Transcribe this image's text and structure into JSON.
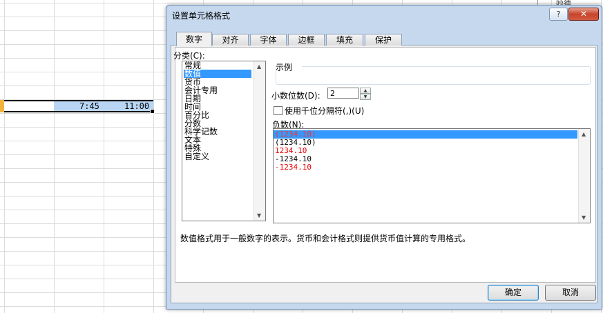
{
  "spreadsheet": {
    "cells": [
      "7:45",
      "11:00"
    ],
    "top_right_label": "吵德"
  },
  "dialog": {
    "title": "设置单元格格式",
    "help_label": "?",
    "close_label": "✕",
    "tabs": [
      "数字",
      "对齐",
      "字体",
      "边框",
      "填充",
      "保护"
    ],
    "category_label": "分类(C):",
    "categories": [
      "常规",
      "数值",
      "货币",
      "会计专用",
      "日期",
      "时间",
      "百分比",
      "分数",
      "科学记数",
      "文本",
      "特殊",
      "自定义"
    ],
    "sample_label": "示例",
    "decimal_label": "小数位数(D):",
    "decimal_value": "2",
    "thousands_label": "使用千位分隔符(,)(U)",
    "negative_label": "负数(N):",
    "negative_options": [
      "(1234.10)",
      "(1234.10)",
      "1234.10",
      "-1234.10",
      "-1234.10"
    ],
    "description": "数值格式用于一般数字的表示。货币和会计格式则提供货币值计算的专用格式。",
    "ok_label": "确定",
    "cancel_label": "取消"
  }
}
